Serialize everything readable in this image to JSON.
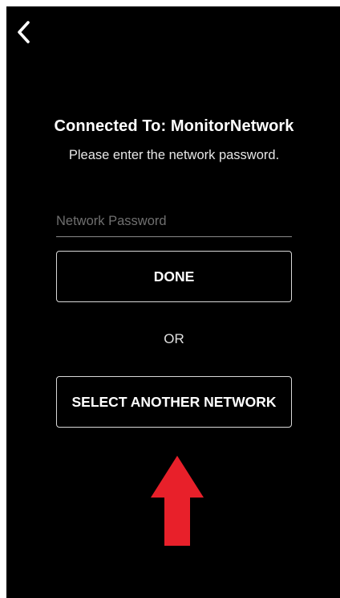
{
  "header": {
    "back_icon": "chevron-left-icon"
  },
  "main": {
    "title": "Connected To: MonitorNetwork",
    "subtitle": "Please enter the network password.",
    "password_placeholder": "Network Password",
    "password_value": "",
    "done_label": "DONE",
    "or_label": "OR",
    "select_network_label": "SELECT ANOTHER NETWORK"
  },
  "annotation": {
    "arrow_icon": "up-arrow-icon",
    "arrow_color": "#e8202a"
  },
  "colors": {
    "background": "#000000",
    "text": "#ffffff",
    "button_border": "#d8d8d8"
  }
}
